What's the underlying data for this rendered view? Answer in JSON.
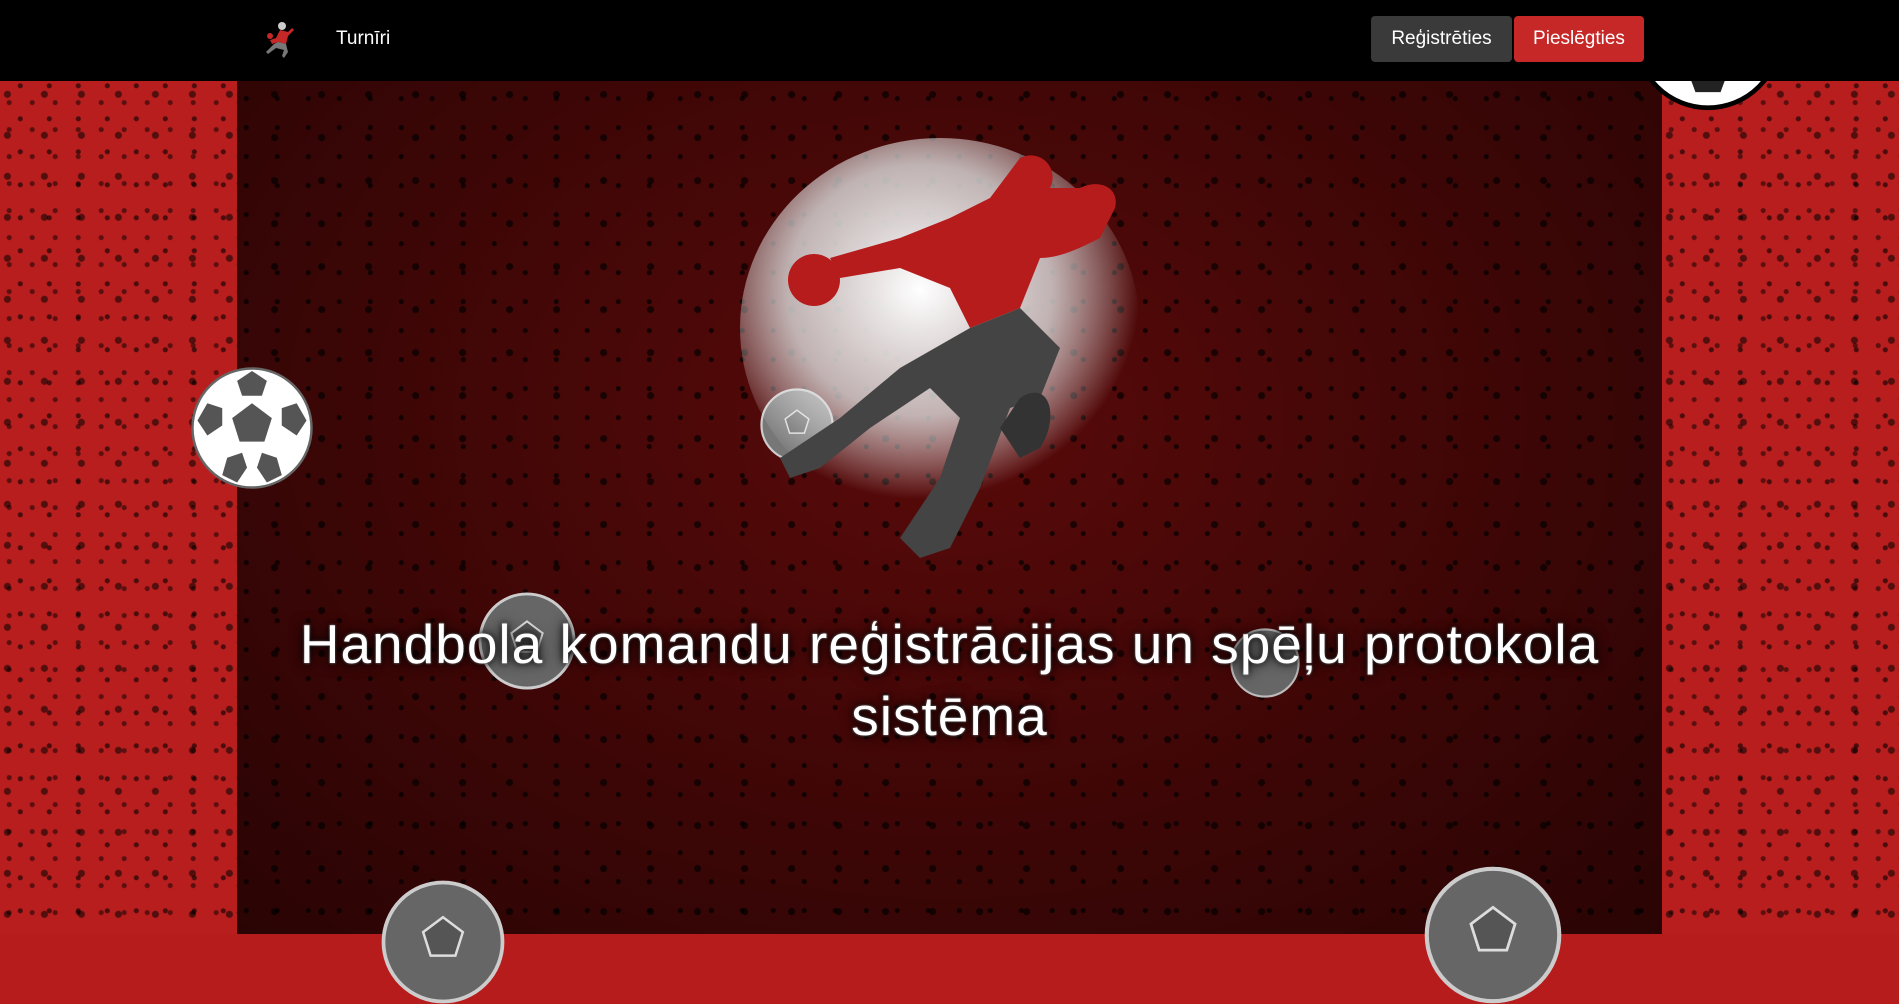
{
  "navbar": {
    "logo": "handball-player-logo",
    "links": [
      {
        "label": "Turnīri"
      }
    ],
    "register_label": "Reģistrēties",
    "login_label": "Pieslēgties"
  },
  "hero": {
    "title": "Handbola komandu reģistrācijas un spēļu protokola sistēma",
    "image": "handball-player-silhouette"
  },
  "colors": {
    "accent": "#c62828",
    "navbar_bg": "#000000",
    "register_bg": "#3a3a3a",
    "side_bg": "#b81e1e"
  }
}
